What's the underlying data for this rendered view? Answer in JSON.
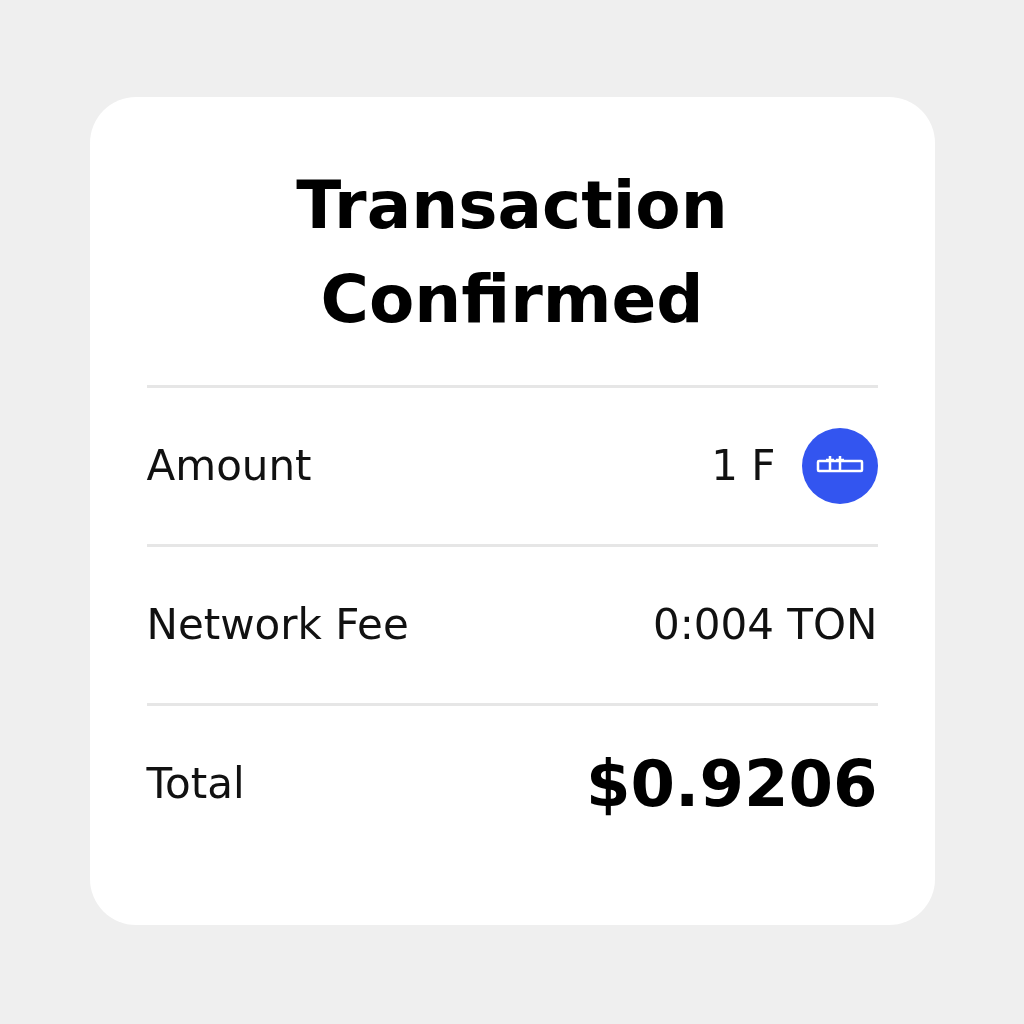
{
  "card": {
    "title": "Transaction Confirmed",
    "rows": [
      {
        "kind": "token",
        "label": "Amount",
        "value": "1 F"
      },
      {
        "kind": "plain",
        "label": "Network Fee",
        "value": "0:004 TON"
      },
      {
        "kind": "total",
        "label": "Total",
        "value": "$0.9206"
      }
    ]
  }
}
